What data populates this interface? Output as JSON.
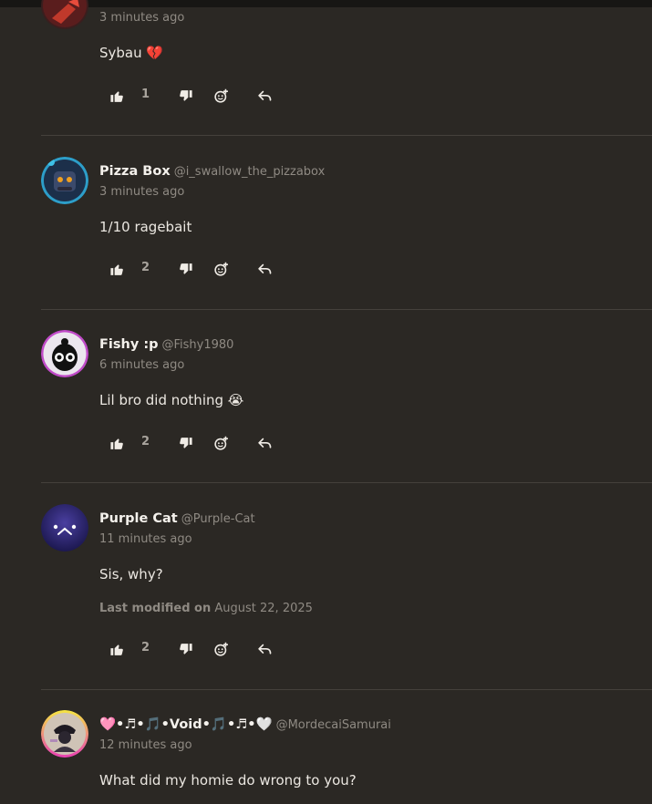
{
  "comments": [
    {
      "name": "",
      "handle": "",
      "time": "3 minutes ago",
      "text": "Sybau",
      "emoji": "💔",
      "modified_label": "",
      "modified_date": "",
      "likes": "1",
      "avatar": "red-figure-avatar"
    },
    {
      "name": "Pizza Box",
      "handle": "@i_swallow_the_pizzabox",
      "time": "3 minutes ago",
      "text": "1/10 ragebait",
      "emoji": "",
      "modified_label": "",
      "modified_date": "",
      "likes": "2",
      "avatar": "robot-avatar"
    },
    {
      "name": "Fishy :p",
      "handle": "@Fishy1980",
      "time": "6 minutes ago",
      "text": "Lil bro did nothing",
      "emoji": "😭",
      "modified_label": "",
      "modified_date": "",
      "likes": "2",
      "avatar": "black-creature-avatar"
    },
    {
      "name": "Purple Cat",
      "handle": "@Purple-Cat",
      "time": "11 minutes ago",
      "text": "Sis, why?",
      "emoji": "",
      "modified_label": "Last modified on",
      "modified_date": "August 22, 2025",
      "likes": "2",
      "avatar": "purple-face-avatar"
    },
    {
      "name": "🩷•♬•🎵•Void•🎵•♬•🤍",
      "handle": "@MordecaiSamurai",
      "time": "12 minutes ago",
      "text": "What did my homie do wrong to you?",
      "emoji": "",
      "modified_label": "",
      "modified_date": "",
      "likes": "",
      "avatar": "void-avatar"
    }
  ],
  "icons": {
    "like": "thumbs-up-icon",
    "dislike": "thumbs-down-icon",
    "react": "add-reaction-icon",
    "reply": "reply-icon"
  },
  "colors": {
    "background": "#2b2824",
    "topbar": "#171614",
    "divider": "#45413c",
    "muted": "#8f8a83"
  }
}
